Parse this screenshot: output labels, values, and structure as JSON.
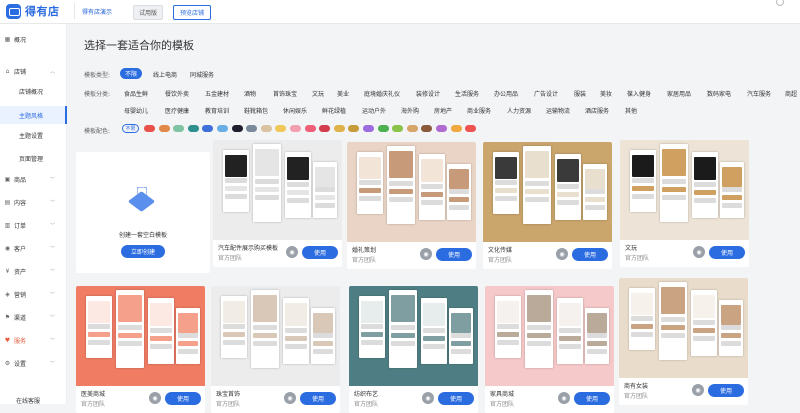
{
  "topbar": {
    "logo_text": "得有店",
    "shop_name": "得有店演示",
    "trial_badge": "试用版",
    "preview_label": "预览店铺"
  },
  "sidebar": {
    "overview": "概况",
    "shop": "店铺",
    "shop_children": [
      "店铺概况",
      "主题风格",
      "主题设置",
      "页面管理"
    ],
    "items": [
      "商品",
      "内容",
      "订单",
      "客户",
      "资产",
      "营销",
      "渠道",
      "服务",
      "设置"
    ],
    "bottom_link": "在线客服"
  },
  "main": {
    "title": "选择一套适合你的模板",
    "template_type_label": "模板类型:",
    "template_types": [
      "不限",
      "线上电商",
      "同城服务"
    ],
    "category_label": "模板分类:",
    "categories_row1": [
      "食品生鲜",
      "餐饮外卖",
      "五金建材",
      "酒物",
      "首饰珠宝",
      "文玩",
      "美业",
      "庭境婚庆礼仪",
      "装修设计",
      "生活服务",
      "办公用品",
      "广告设计",
      "服装",
      "美妆",
      "葆入健身",
      "家居用品",
      "数码家电",
      "汽车服务",
      "商超"
    ],
    "categories_row2": [
      "母婴幼儿",
      "医疗健康",
      "教育培训",
      "鞋靴箱包",
      "休闲娱乐",
      "鲜花绿植",
      "运动户外",
      "海外购",
      "房地产",
      "商业服务",
      "人力资源",
      "运输物流",
      "酒店服务",
      "其他"
    ],
    "color_label": "模板配色:",
    "color_none": "不限",
    "colors": [
      "#e8524a",
      "#e0894a",
      "#7fc3a2",
      "#2f8f8d",
      "#3f6fd8",
      "#6aaee8",
      "#1e1e2e",
      "#7a8a9a",
      "#d9c3a0",
      "#f0c85a",
      "#f29fb0",
      "#ef5f77",
      "#d43d4e",
      "#e0b24a",
      "#c79a3a",
      "#9c6be0",
      "#4caf50",
      "#8bc34a",
      "#d8a56a",
      "#8a5a3a",
      "#b06bd0",
      "#f0a840",
      "#ef5350"
    ],
    "blank_card": {
      "text": "创建一套空白模板",
      "button": "立即创建"
    },
    "cards": [
      {
        "name": "汽车配件展示购买模板",
        "team": "官方团队",
        "use": "使用"
      },
      {
        "name": "婚礼策划",
        "team": "官方团队",
        "use": "使用"
      },
      {
        "name": "文化传媒",
        "team": "官方团队",
        "use": "使用"
      },
      {
        "name": "文玩",
        "team": "官方团队",
        "use": "使用"
      },
      {
        "name": "医美商城",
        "team": "官方团队",
        "use": "使用"
      },
      {
        "name": "珠宝首饰",
        "team": "官方团队",
        "use": "使用"
      },
      {
        "name": "纺织布艺",
        "team": "官方团队",
        "use": "使用"
      },
      {
        "name": "家具商城",
        "team": "官方团队",
        "use": "使用"
      },
      {
        "name": "商有女装",
        "team": "官方团队",
        "use": "使用"
      }
    ]
  }
}
